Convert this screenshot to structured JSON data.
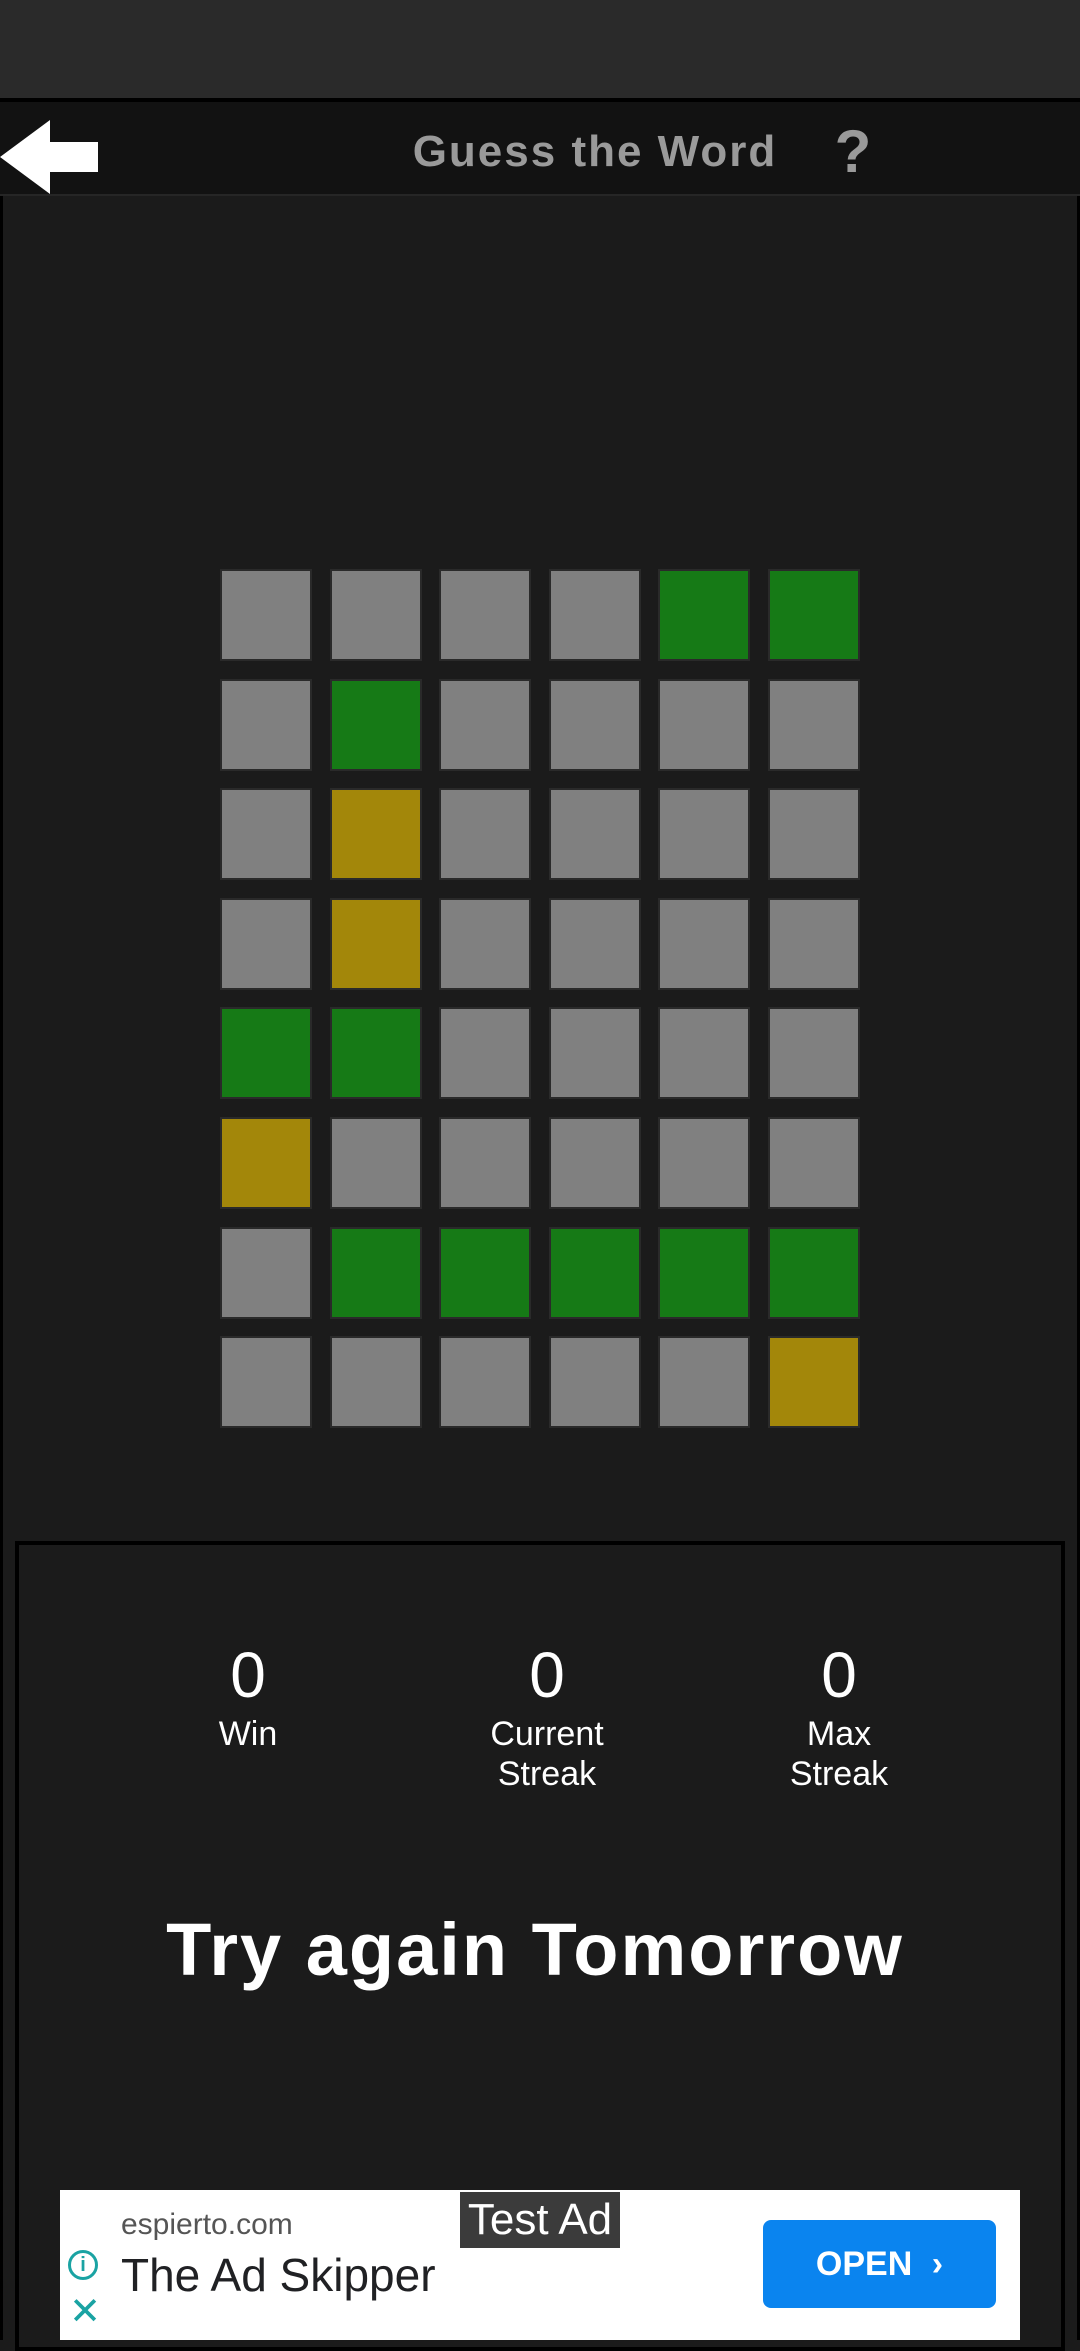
{
  "header": {
    "title": "Guess the Word",
    "help_label": "?"
  },
  "board": {
    "colors": {
      "gray": "#808080",
      "green": "#167a16",
      "yellow": "#a3870a"
    },
    "rows": [
      [
        "gray",
        "gray",
        "gray",
        "gray",
        "green",
        "green"
      ],
      [
        "gray",
        "green",
        "gray",
        "gray",
        "gray",
        "gray"
      ],
      [
        "gray",
        "yellow",
        "gray",
        "gray",
        "gray",
        "gray"
      ],
      [
        "gray",
        "yellow",
        "gray",
        "gray",
        "gray",
        "gray"
      ],
      [
        "green",
        "green",
        "gray",
        "gray",
        "gray",
        "gray"
      ],
      [
        "yellow",
        "gray",
        "gray",
        "gray",
        "gray",
        "gray"
      ],
      [
        "gray",
        "green",
        "green",
        "green",
        "green",
        "green"
      ],
      [
        "gray",
        "gray",
        "gray",
        "gray",
        "gray",
        "yellow"
      ]
    ]
  },
  "stats": {
    "win": {
      "value": "0",
      "label": "Win"
    },
    "current_streak": {
      "value": "0",
      "label_line1": "Current",
      "label_line2": "Streak"
    },
    "max_streak": {
      "value": "0",
      "label_line1": "Max",
      "label_line2": "Streak"
    }
  },
  "result_message": "Try again Tomorrow",
  "ad": {
    "badge": "Test Ad",
    "domain": "espierto.com",
    "title": "The Ad Skipper",
    "cta_label": "OPEN",
    "cta_color": "#0a84ef"
  }
}
